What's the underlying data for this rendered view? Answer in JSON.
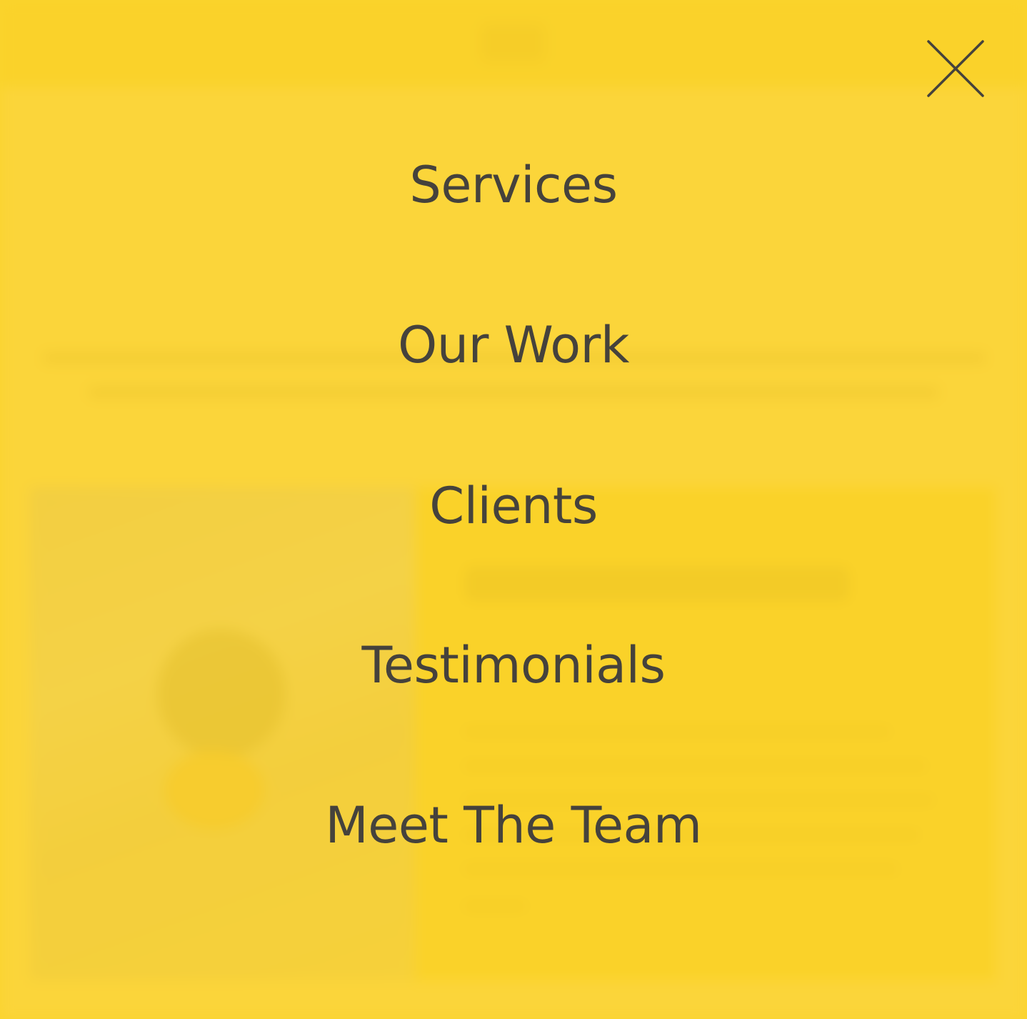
{
  "close_button": {
    "icon": "close-icon",
    "color": "#45423c"
  },
  "menu": {
    "items": [
      {
        "label": "Services"
      },
      {
        "label": "Our Work"
      },
      {
        "label": "Clients"
      },
      {
        "label": "Testimonials"
      },
      {
        "label": "Meet The Team"
      }
    ],
    "text_color": "#45423c",
    "overlay_color": "#f9d21c"
  }
}
